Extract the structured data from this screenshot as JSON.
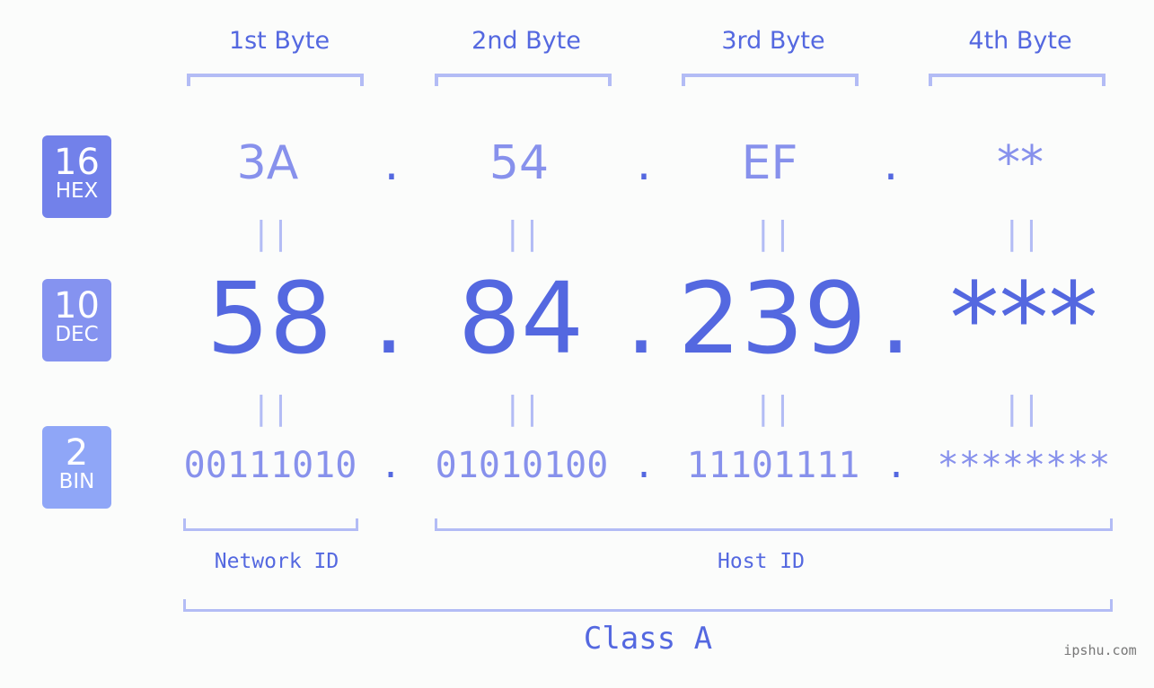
{
  "bytes": {
    "labels": [
      "1st Byte",
      "2nd Byte",
      "3rd Byte",
      "4th Byte"
    ]
  },
  "badges": {
    "hex": {
      "number": "16",
      "name": "HEX",
      "color": "#7281ea"
    },
    "dec": {
      "number": "10",
      "name": "DEC",
      "color": "#8593f0"
    },
    "bin": {
      "number": "2",
      "name": "BIN",
      "color": "#8fa6f7"
    }
  },
  "hex": {
    "values": [
      "3A",
      "54",
      "EF",
      "**"
    ],
    "separator": "."
  },
  "dec": {
    "values": [
      "58",
      "84",
      "239",
      "***"
    ],
    "separator": "."
  },
  "bin": {
    "values": [
      "00111010",
      "01010100",
      "11101111",
      "********"
    ],
    "separator": "."
  },
  "equals_sign": "||",
  "ids": {
    "network": "Network ID",
    "host": "Host ID"
  },
  "class_label": "Class A",
  "watermark": "ipshu.com",
  "colors": {
    "primary": "#5468e0",
    "secondary": "#8791ec",
    "bracket": "#b3bcf5",
    "background": "#fbfcfb"
  }
}
